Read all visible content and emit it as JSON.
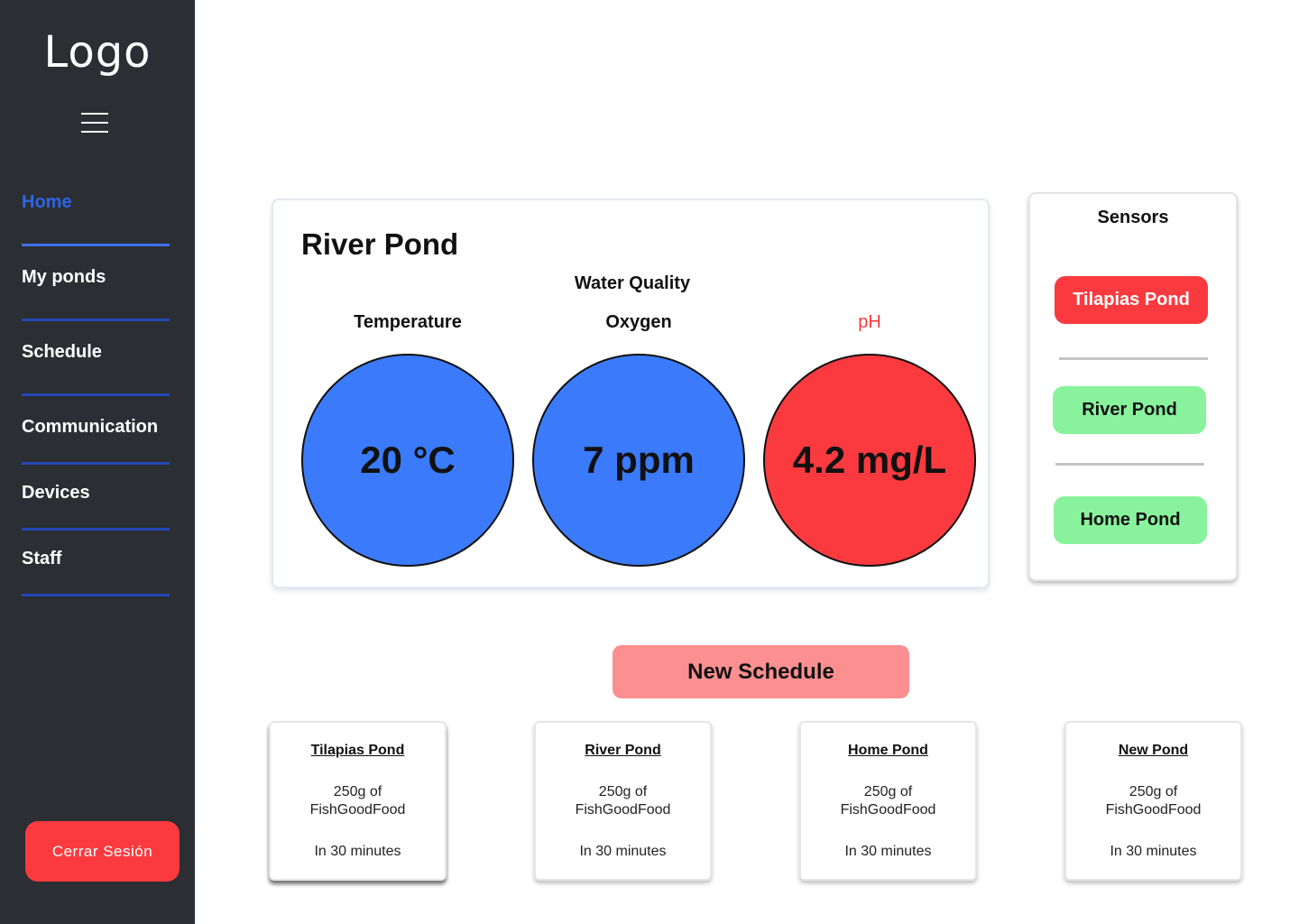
{
  "sidebar": {
    "logo": "Logo",
    "menu_icon": "hamburger-icon",
    "nav": [
      {
        "label": "Home",
        "active": true
      },
      {
        "label": "My ponds"
      },
      {
        "label": "Schedule"
      },
      {
        "label": "Communication"
      },
      {
        "label": "Devices"
      },
      {
        "label": "Staff"
      }
    ],
    "logout_label": "Cerrar  Sesión"
  },
  "quality": {
    "pond_name": "River Pond",
    "section_title": "Water Quality",
    "metrics": [
      {
        "label": "Temperature",
        "value": "20 °C",
        "status": "normal",
        "color": "#3b7bfb"
      },
      {
        "label": "Oxygen",
        "value": "7 ppm",
        "status": "normal",
        "color": "#3b7bfb"
      },
      {
        "label": "pH",
        "value": "4.2 mg/L",
        "status": "alert",
        "color": "#fb3a3f"
      }
    ]
  },
  "sensors": {
    "title": "Sensors",
    "items": [
      {
        "label": "Tilapias Pond",
        "status": "alert"
      },
      {
        "label": "River Pond",
        "status": "ok"
      },
      {
        "label": "Home Pond",
        "status": "ok"
      }
    ]
  },
  "schedule": {
    "new_label": "New Schedule",
    "cards": [
      {
        "pond": "Tilapias Pond",
        "amount_line1": "250g of",
        "amount_line2": "FishGoodFood",
        "time": "In 30 minutes"
      },
      {
        "pond": "River Pond",
        "amount_line1": "250g of",
        "amount_line2": "FishGoodFood",
        "time": "In 30 minutes"
      },
      {
        "pond": "Home Pond",
        "amount_line1": "250g of",
        "amount_line2": "FishGoodFood",
        "time": "In 30 minutes"
      },
      {
        "pond": "New Pond",
        "amount_line1": "250g of",
        "amount_line2": "FishGoodFood",
        "time": "In 30 minutes"
      }
    ]
  },
  "colors": {
    "sidebar_bg": "#2b2e33",
    "accent_blue": "#3b7bfb",
    "alert_red": "#fb3a3f",
    "ok_green": "#88f39c",
    "schedule_button": "#fc8f8f"
  }
}
